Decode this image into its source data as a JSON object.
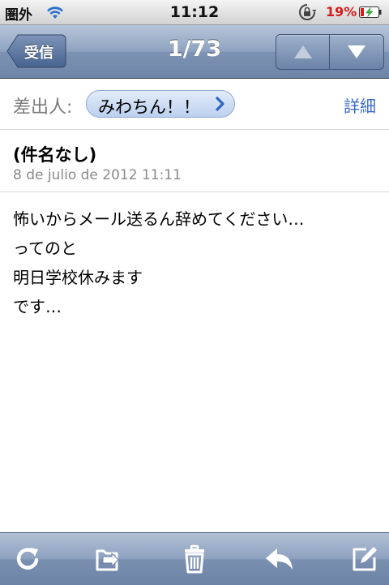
{
  "status_bar": {
    "carrier": "圏外",
    "time": "11:12",
    "battery_percent": "19",
    "battery_percent_sign": "%",
    "battery_level": 0.19,
    "battery_color": "#d31d1d",
    "icons": [
      "wifi-icon",
      "rotation-lock-icon",
      "battery-charging-icon"
    ]
  },
  "nav": {
    "back_label": "受信",
    "title": "1/73",
    "prev_icon": "up-arrow-icon",
    "next_icon": "down-arrow-icon"
  },
  "header": {
    "from_label": "差出人:",
    "sender": "みわちん！！",
    "details_label": "詳細",
    "subject": "(件名なし)",
    "date": "8 de julio de 2012 11:11"
  },
  "body": {
    "lines": [
      "怖いからメール送るん辞めてください…",
      "ってのと",
      "明日学校休みます",
      "です…"
    ]
  },
  "toolbar": {
    "icons": [
      "refresh-icon",
      "move-folder-icon",
      "trash-icon",
      "reply-icon",
      "compose-icon"
    ]
  },
  "colors": {
    "link": "#3a6cc4",
    "nav_bar": "#7d93b3"
  }
}
